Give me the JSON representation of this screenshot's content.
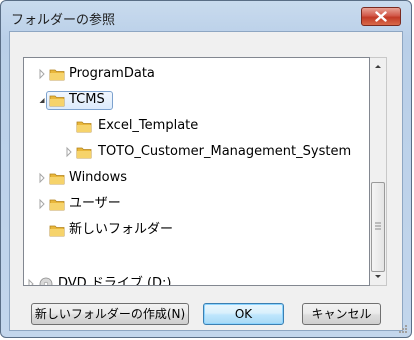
{
  "dialog": {
    "title": "フォルダーの参照",
    "close_icon": "close-x-icon"
  },
  "tree": {
    "items": [
      {
        "label": "ProgramData",
        "expander": "collapsed",
        "selected": false
      },
      {
        "label": "TCMS",
        "expander": "expanded",
        "selected": true
      },
      {
        "label": "Excel_Template",
        "expander": "none",
        "selected": false
      },
      {
        "label": "TOTO_Customer_Management_System",
        "expander": "collapsed",
        "selected": false
      },
      {
        "label": "Windows",
        "expander": "collapsed",
        "selected": false
      },
      {
        "label": "ユーザー",
        "expander": "collapsed",
        "selected": false
      },
      {
        "label": "新しいフォルダー",
        "expander": "none",
        "selected": false
      },
      {
        "label": "DVD ドライブ (D:)",
        "expander": "collapsed",
        "selected": false,
        "icon": "dvd-drive-icon"
      }
    ]
  },
  "buttons": {
    "new_folder": "新しいフォルダーの作成(N)",
    "ok": "OK",
    "cancel": "キャンセル"
  },
  "colors": {
    "titlebar": "#c4d8ee",
    "close_button": "#c9402a",
    "selection_border": "#7da2ce",
    "folder": "#e9b73a"
  }
}
